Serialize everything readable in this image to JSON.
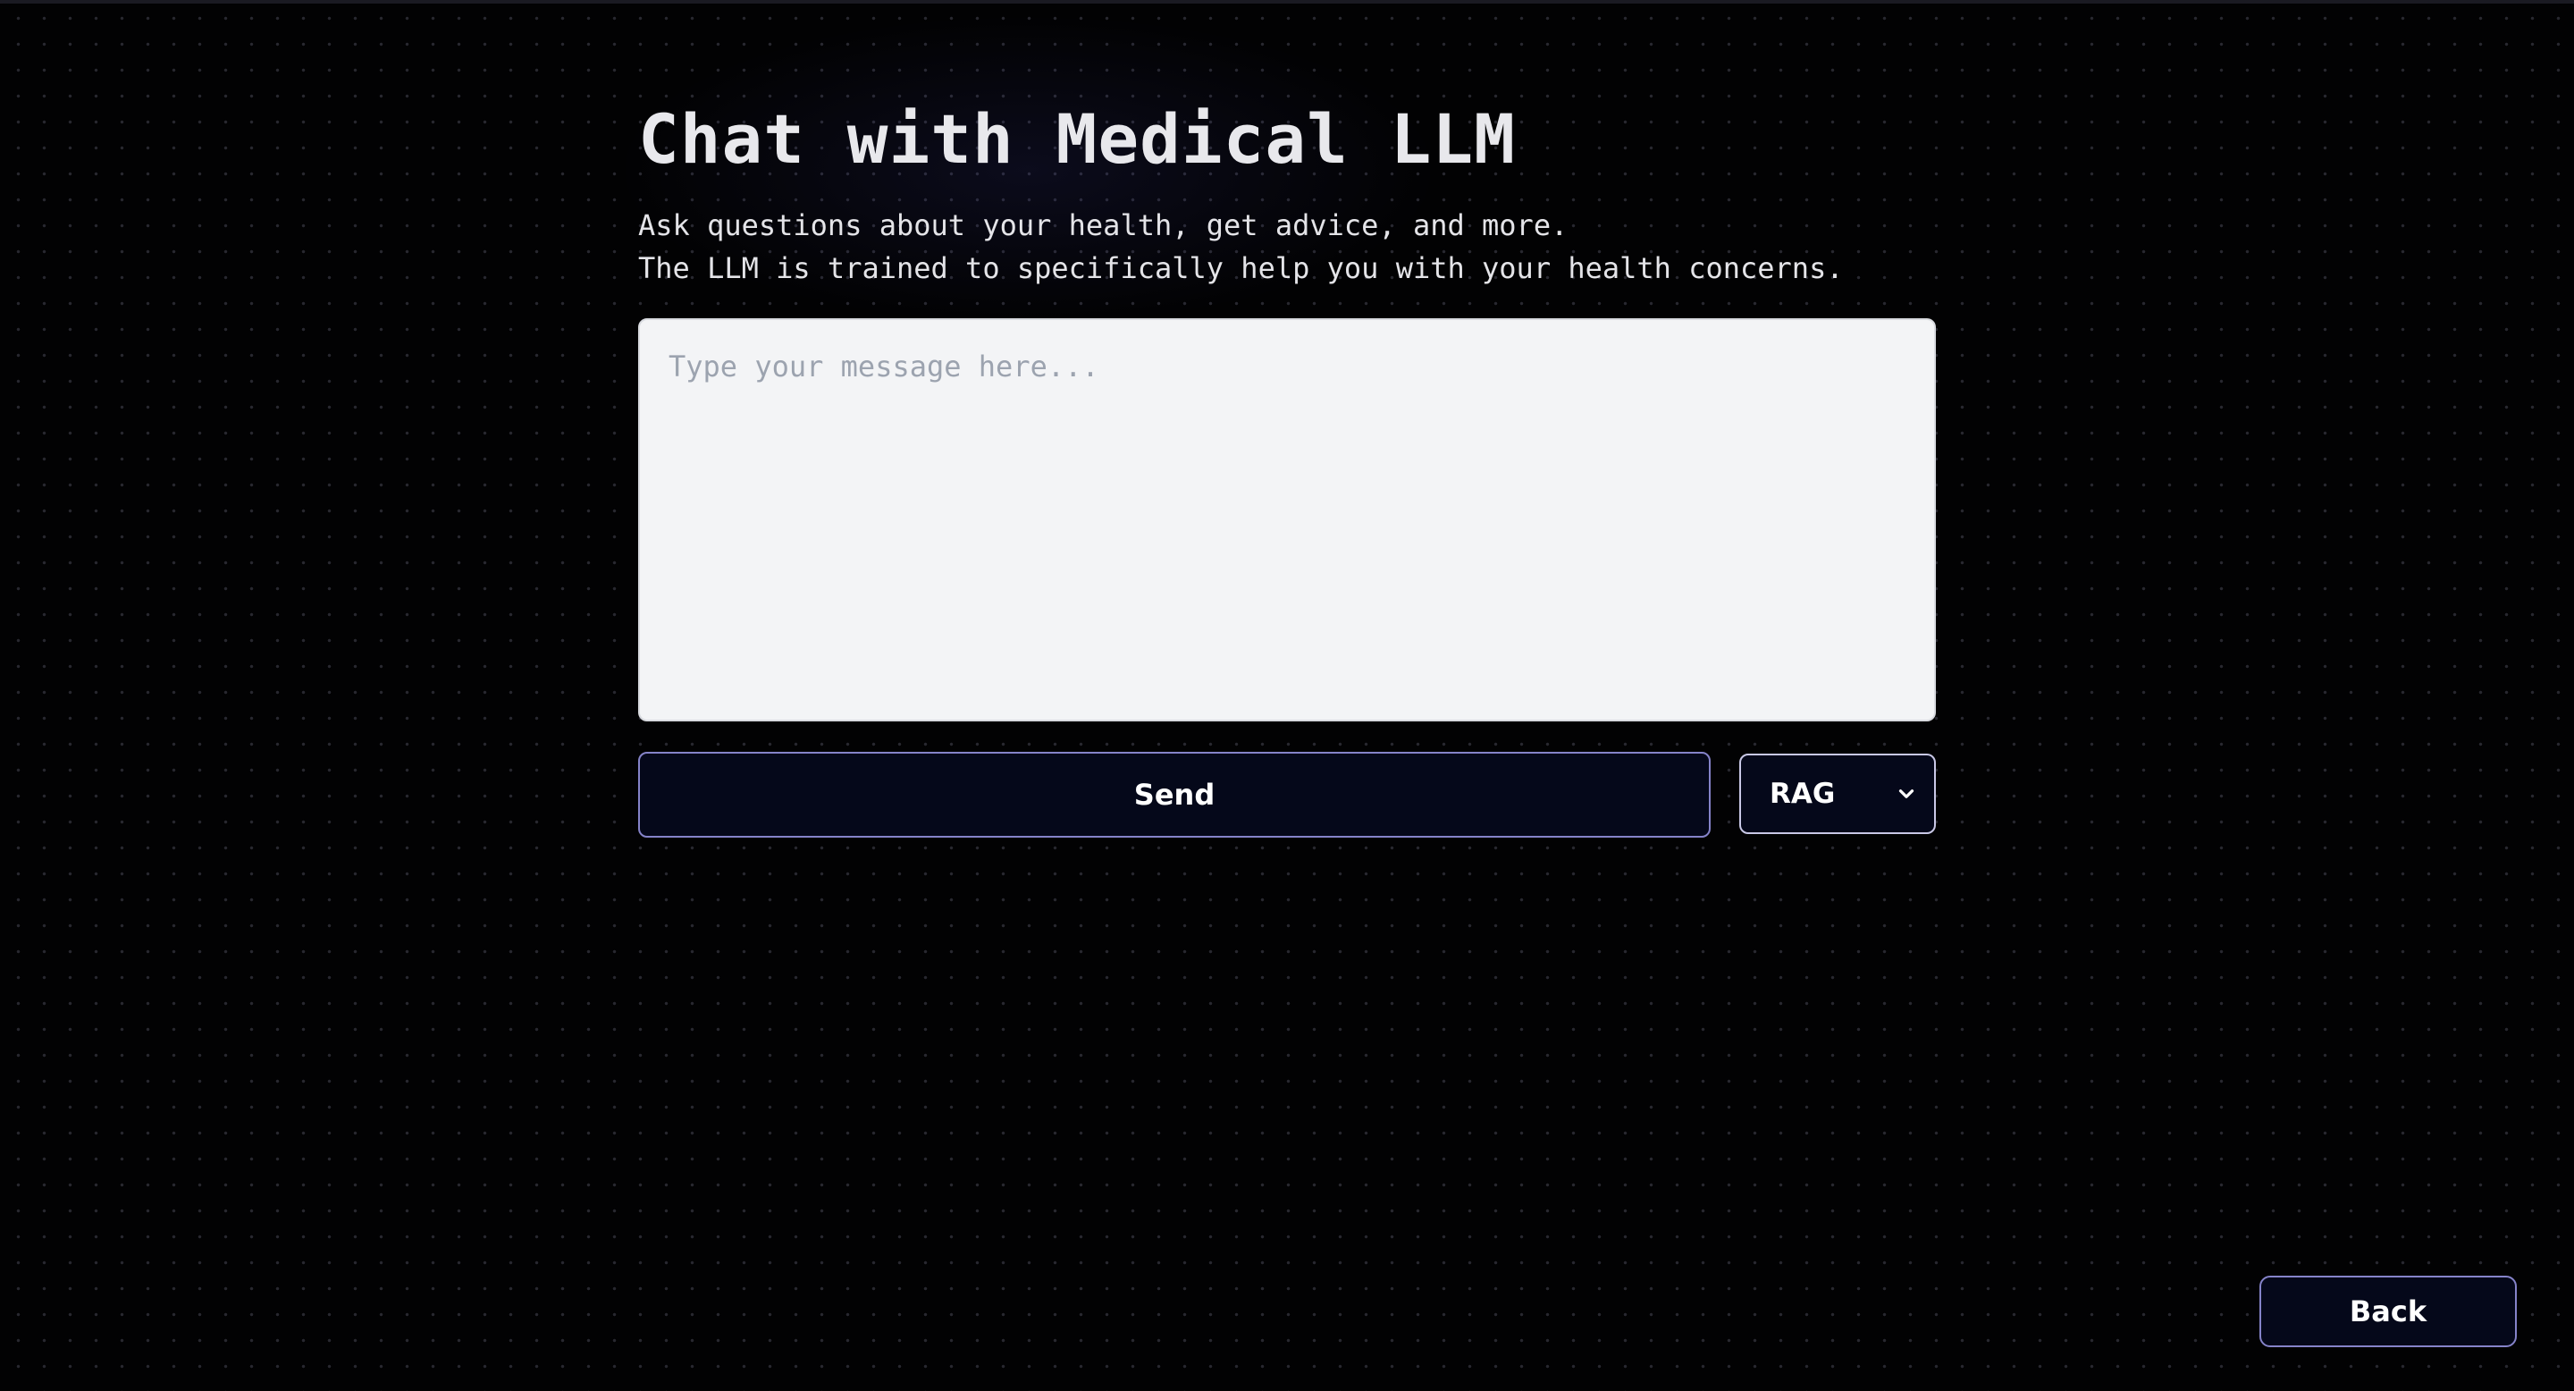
{
  "page": {
    "title": "Chat with Medical LLM",
    "subtitle_lines": [
      "Ask questions about your health, get advice, and more.",
      "The LLM is trained to specifically help you with your health concerns."
    ]
  },
  "chat": {
    "input_value": "",
    "input_placeholder": "Type your message here...",
    "send_label": "Send",
    "mode": {
      "selected": "RAG",
      "icon": "chevron-down-icon"
    }
  },
  "nav": {
    "back_label": "Back"
  },
  "colors": {
    "background": "#020203",
    "button_background": "#05081a",
    "button_border": "#8583c9",
    "input_background": "#f3f4f6"
  }
}
